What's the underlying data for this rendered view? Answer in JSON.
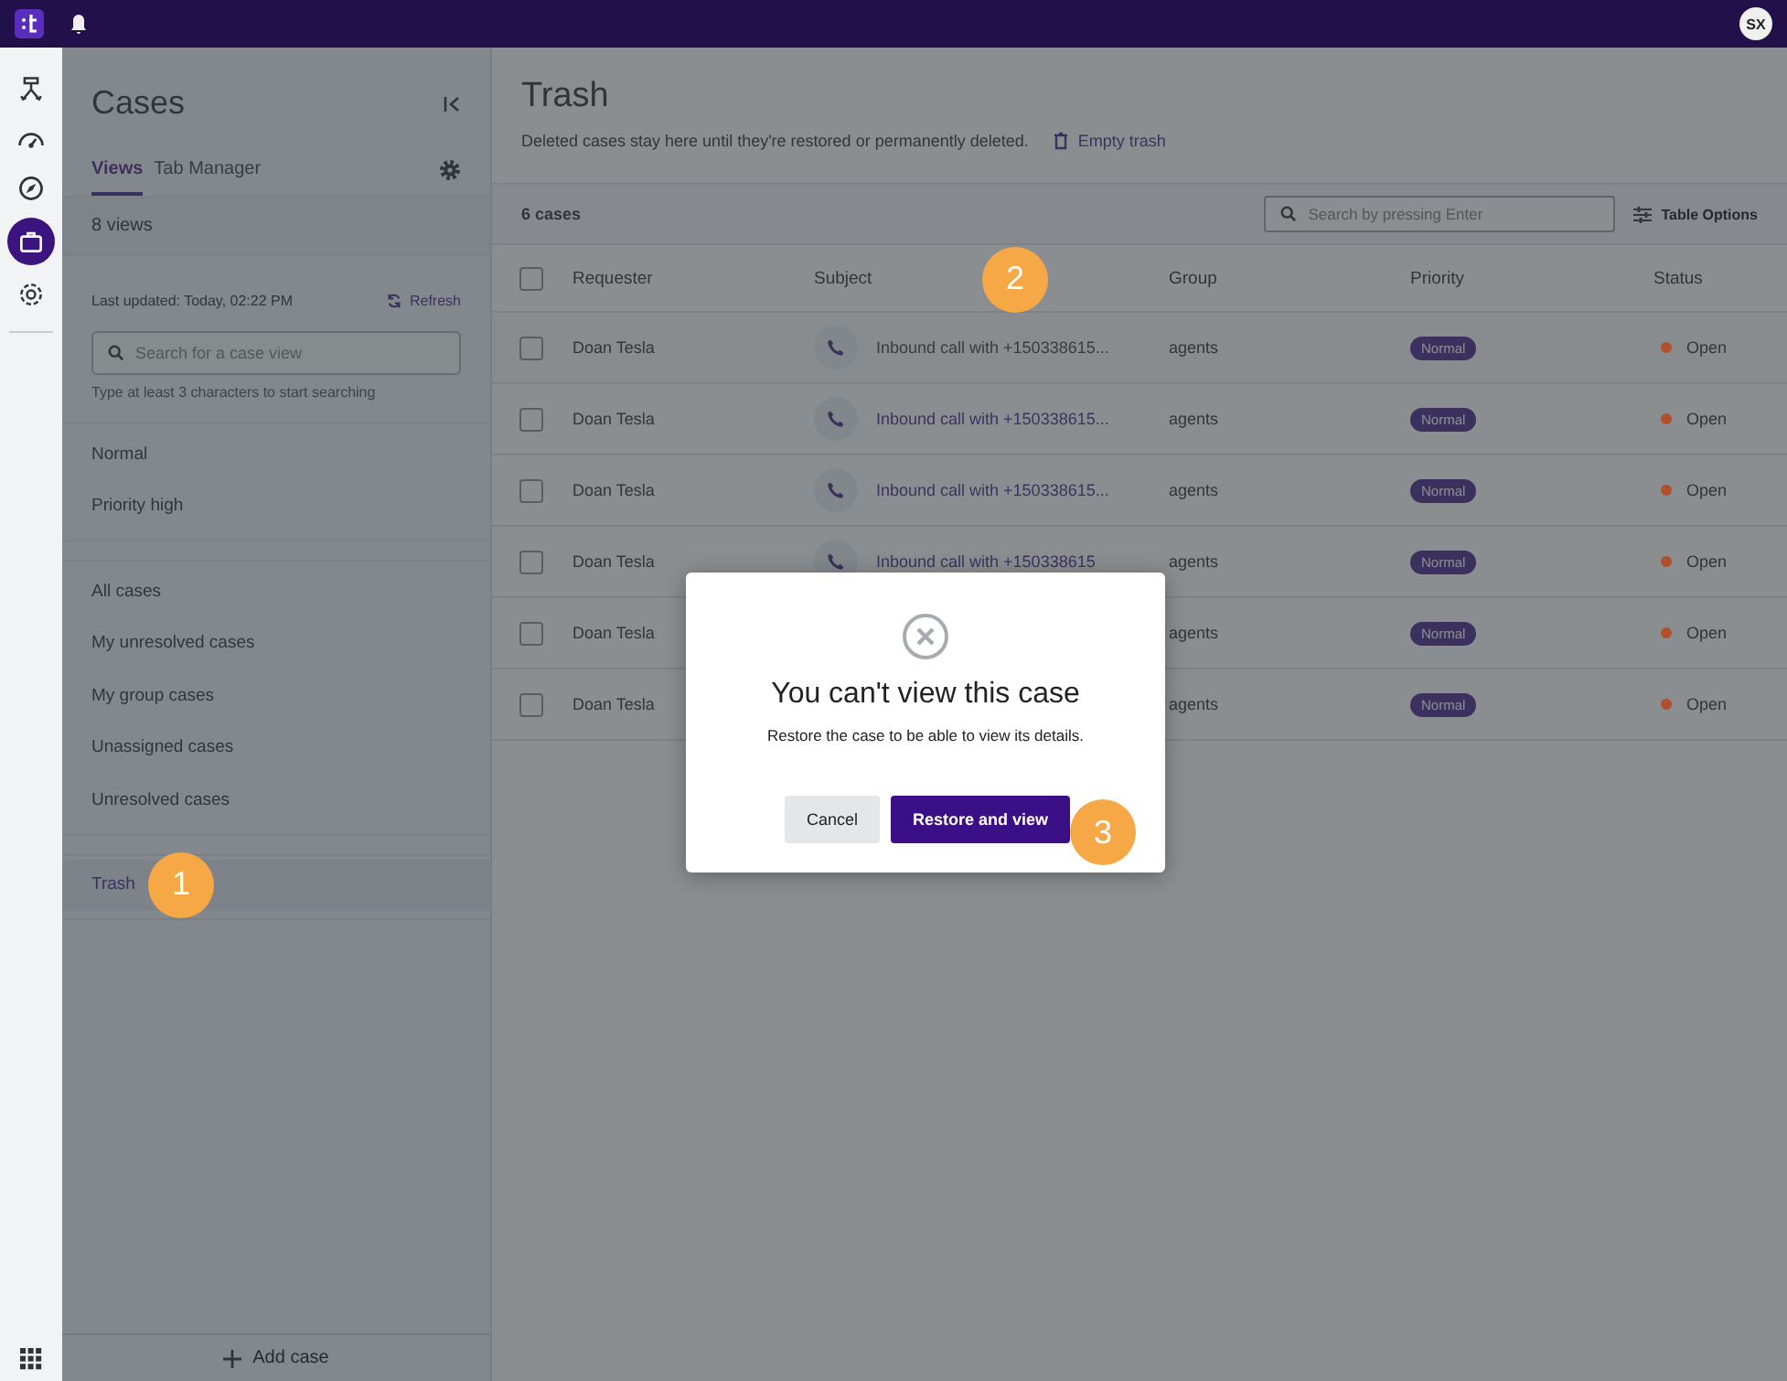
{
  "topbar": {
    "avatar_initials": "SX"
  },
  "rail": [
    {
      "selected": false
    },
    {
      "selected": false
    },
    {
      "selected": false
    },
    {
      "selected": true
    },
    {
      "selected": false
    }
  ],
  "sidebar": {
    "title": "Cases",
    "tabs": [
      {
        "label": "Views",
        "selected": true
      },
      {
        "label": "Tab Manager",
        "selected": false
      }
    ],
    "views_count": "8 views",
    "last_updated": "Last updated:  Today, 02:22 PM",
    "refresh": "Refresh",
    "search": {
      "placeholder": "Search for a case view"
    },
    "search_hint": "Type at least 3 characters to start searching",
    "view_groups": [
      [
        {
          "label": "Normal",
          "selected": false
        },
        {
          "label": "Priority high",
          "selected": false
        }
      ],
      [
        {
          "label": "All cases",
          "selected": false
        },
        {
          "label": "My unresolved cases",
          "selected": false
        },
        {
          "label": "My group cases",
          "selected": false
        },
        {
          "label": "Unassigned cases",
          "selected": false
        },
        {
          "label": "Unresolved cases",
          "selected": false
        }
      ],
      [
        {
          "label": "Trash",
          "selected": true
        }
      ]
    ],
    "add_case": "Add case"
  },
  "main": {
    "title": "Trash",
    "description": "Deleted cases stay here until they're restored or permanently deleted.",
    "empty_trash": "Empty trash",
    "count": "6 cases",
    "search": {
      "placeholder": "Search by pressing Enter"
    },
    "table_options": "Table Options",
    "table": {
      "select_all_checked": false,
      "columns": [
        "Requester",
        "Subject",
        "Group",
        "Priority",
        "Status"
      ],
      "rows": [
        {
          "checked": false,
          "requester": "Doan Tesla",
          "subject": "Inbound call with +150338615...",
          "hovered": true,
          "group": "agents",
          "priority": "Normal",
          "status": "Open",
          "color": "#b0502c"
        },
        {
          "checked": false,
          "requester": "Doan Tesla",
          "subject": "Inbound call with +150338615...",
          "hovered": false,
          "group": "agents",
          "priority": "Normal",
          "status": "Open",
          "color": "#b0502c"
        },
        {
          "checked": false,
          "requester": "Doan Tesla",
          "subject": "Inbound call with +150338615...",
          "hovered": false,
          "group": "agents",
          "priority": "Normal",
          "status": "Open",
          "color": "#b0502c"
        },
        {
          "checked": false,
          "requester": "Doan Tesla",
          "subject": "Inbound call with +150338615",
          "hovered": false,
          "group": "agents",
          "priority": "Normal",
          "status": "Open",
          "color": "#b0502c"
        },
        {
          "checked": false,
          "requester": "Doan Tesla",
          "group": "agents",
          "priority": "Normal",
          "status": "Open",
          "color": "#b0502c"
        },
        {
          "checked": false,
          "requester": "Doan Tesla",
          "group": "agents",
          "priority": "Normal",
          "status": "Open",
          "color": "#b0502c"
        }
      ]
    }
  },
  "modal": {
    "title": "You can't view this case",
    "message": "Restore the case to be able to view its details.",
    "buttons": [
      {
        "label": "Cancel",
        "kind": "secondary"
      },
      {
        "label": "Restore and view",
        "kind": "primary"
      }
    ]
  },
  "callouts": [
    "1",
    "2",
    "3"
  ]
}
